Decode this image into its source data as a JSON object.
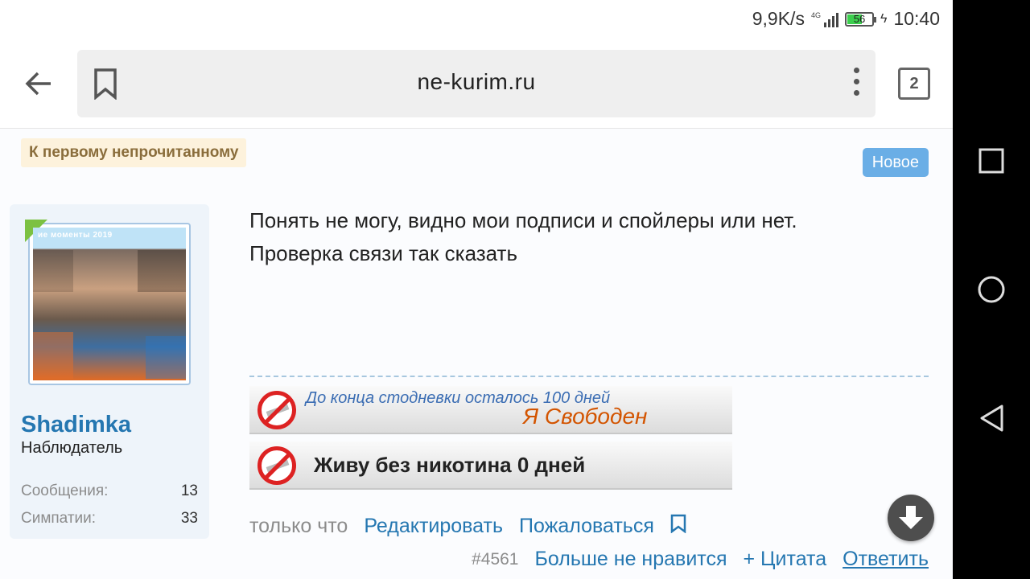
{
  "status": {
    "net_speed": "9,9K/s",
    "network": "4G",
    "battery": "56",
    "time": "10:40"
  },
  "browser": {
    "url": "ne-kurim.ru",
    "tab_count": "2"
  },
  "thread": {
    "unread_link": "К первому непрочитанному",
    "new_badge": "Новое"
  },
  "user": {
    "name": "Shadimka",
    "title": "Наблюдатель",
    "stats": [
      {
        "label": "Сообщения:",
        "value": "13"
      },
      {
        "label": "Симпатии:",
        "value": "33"
      }
    ]
  },
  "post": {
    "line1": "Понять не могу, видно мои подписи и спойлеры или нет.",
    "line2": "Проверка связи так сказать",
    "banner1_line1": "До конца стодневки осталось 100 дней",
    "banner1_line2": "Я Свободен",
    "banner2_text": "Живу без никотина 0 дней",
    "time": "только что",
    "edit": "Редактировать",
    "report": "Пожаловаться",
    "number": "#4561",
    "unlike": "Больше не нравится",
    "quote": "+ Цитата",
    "reply": "Ответить"
  },
  "avatar": {
    "header_text": "ие моменты 2019"
  },
  "colors": {
    "link": "#2577b1",
    "badge": "#6aaee6",
    "unread_bg": "#fdf2dc",
    "panel_bg": "#eef4fa"
  }
}
